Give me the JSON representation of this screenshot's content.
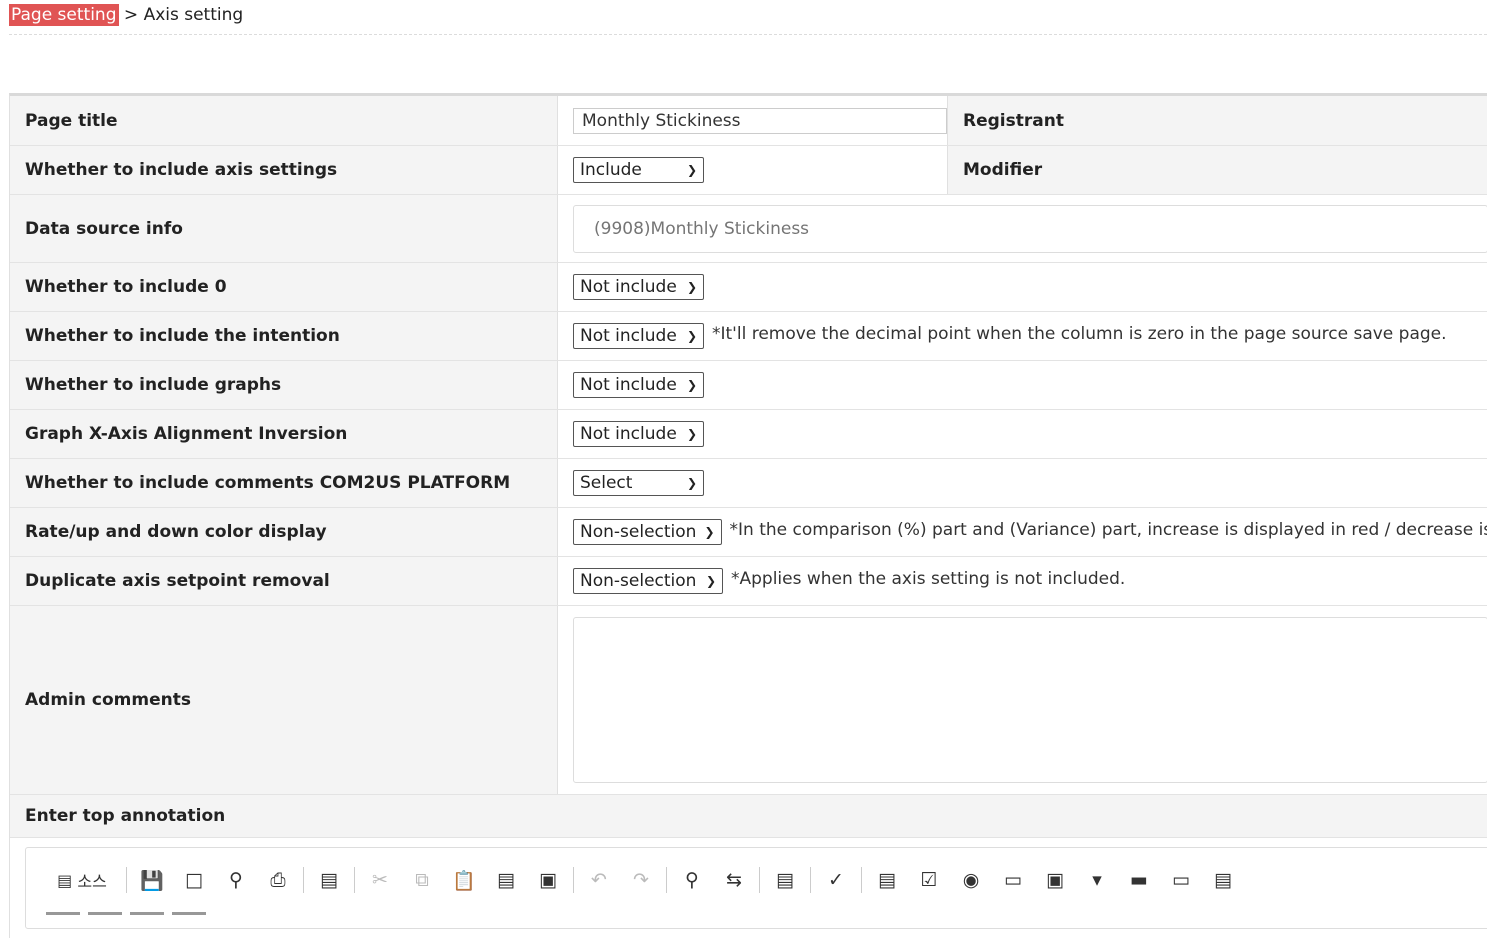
{
  "breadcrumb": {
    "parent": "Page setting",
    "separator": ">",
    "current": "Axis setting"
  },
  "form": {
    "page_title_label": "Page title",
    "page_title_value": "Monthly Stickiness",
    "registrant_label": "Registrant",
    "axis_settings_label": "Whether to include axis settings",
    "axis_settings_value": "Include",
    "modifier_label": "Modifier",
    "data_source_label": "Data source info",
    "data_source_placeholder": "(9908)Monthly Stickiness",
    "include_zero_label": "Whether to include 0",
    "include_zero_value": "Not include",
    "include_intention_label": "Whether to include the intention",
    "include_intention_value": "Not include",
    "include_intention_note": "*It'll remove the decimal point when the column is zero in the page source save page.",
    "include_graphs_label": "Whether to include graphs",
    "include_graphs_value": "Not include",
    "x_axis_inversion_label": "Graph X-Axis Alignment Inversion",
    "x_axis_inversion_value": "Not include",
    "include_comments_label": "Whether to include comments COM2US PLATFORM",
    "include_comments_value": "Select",
    "rate_color_label": "Rate/up and down color display",
    "rate_color_value": "Non-selection",
    "rate_color_note": "*In the comparison (%) part and (Variance) part, increase is displayed in red / decrease is dis",
    "duplicate_removal_label": "Duplicate axis setpoint removal",
    "duplicate_removal_value": "Non-selection",
    "duplicate_removal_note": "*Applies when the axis setting is not included.",
    "admin_comments_label": "Admin comments",
    "top_annotation_label": "Enter top annotation"
  },
  "editor_toolbar": {
    "source_label": "소스",
    "icons": [
      "source-icon",
      "save-icon",
      "new-page-icon",
      "preview-icon",
      "print-icon",
      "templates-icon",
      "cut-icon",
      "copy-icon",
      "paste-icon",
      "paste-text-icon",
      "paste-word-icon",
      "undo-icon",
      "redo-icon",
      "find-icon",
      "replace-icon",
      "select-all-icon",
      "spellcheck-icon",
      "form-icon",
      "checkbox-icon",
      "radio-icon",
      "textfield-icon",
      "textarea-icon",
      "select-field-icon",
      "button-icon",
      "image-button-icon",
      "hidden-field-icon"
    ]
  }
}
